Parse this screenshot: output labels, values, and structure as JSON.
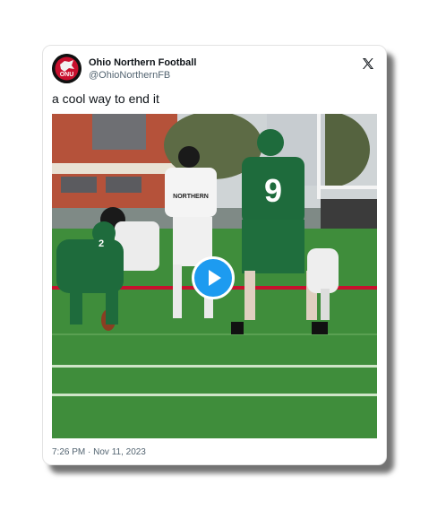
{
  "tweet": {
    "author_name": "Ohio Northern Football",
    "author_handle": "@OhioNorthernFB",
    "text": "a cool way to end it",
    "timestamp": "7:26 PM · Nov 11, 2023",
    "avatar_text": "ONU"
  },
  "media": {
    "jersey_number": "9",
    "shirt_text": "NORTHERN",
    "player_number_alt": "2"
  },
  "colors": {
    "accent_blue": "#1d9bf0",
    "field_green": "#3e8f3a",
    "jersey_green": "#1e6b3c",
    "brand_red": "#c8102e"
  },
  "icons": {
    "logo": "x-logo-icon",
    "play": "play-icon"
  }
}
